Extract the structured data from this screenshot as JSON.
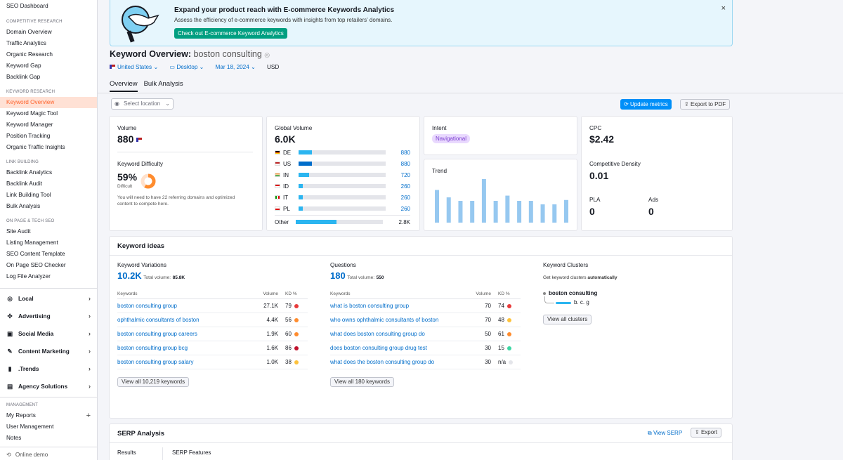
{
  "sidebar": {
    "top": "SEO Dashboard",
    "sections": [
      {
        "title": "COMPETITIVE RESEARCH",
        "items": [
          "Domain Overview",
          "Traffic Analytics",
          "Organic Research",
          "Keyword Gap",
          "Backlink Gap"
        ]
      },
      {
        "title": "KEYWORD RESEARCH",
        "items": [
          "Keyword Overview",
          "Keyword Magic Tool",
          "Keyword Manager",
          "Position Tracking",
          "Organic Traffic Insights"
        ]
      },
      {
        "title": "LINK BUILDING",
        "items": [
          "Backlink Analytics",
          "Backlink Audit",
          "Link Building Tool",
          "Bulk Analysis"
        ]
      },
      {
        "title": "ON PAGE & TECH SEO",
        "items": [
          "Site Audit",
          "Listing Management",
          "SEO Content Template",
          "On Page SEO Checker",
          "Log File Analyzer"
        ]
      }
    ],
    "groups": [
      "Local",
      "Advertising",
      "Social Media",
      "Content Marketing",
      ".Trends",
      "Agency Solutions"
    ],
    "management_title": "MANAGEMENT",
    "management": [
      "My Reports",
      "User Management",
      "Notes"
    ],
    "bottom": "Online demo"
  },
  "banner": {
    "title": "Expand your product reach with E-commerce Keywords Analytics",
    "subtitle": "Assess the efficiency of e-commerce keywords with insights from top retailers' domains.",
    "button": "Check out E-commerce Keyword Analytics",
    "close": "×"
  },
  "header": {
    "title": "Keyword Overview:",
    "keyword": "boston consulting",
    "country": "United States",
    "device": "Desktop",
    "date": "Mar 18, 2024",
    "currency": "USD",
    "tabs": [
      "Overview",
      "Bulk Analysis"
    ]
  },
  "toolbar": {
    "location_placeholder": "Select location",
    "update": "Update metrics",
    "export": "Export to PDF"
  },
  "volume": {
    "label": "Volume",
    "value": "880"
  },
  "difficulty": {
    "label": "Keyword Difficulty",
    "value": "59%",
    "level": "Difficult",
    "percent": 59,
    "note": "You will need to have 22 referring domains and optimized content to compete here."
  },
  "global": {
    "label": "Global Volume",
    "value": "6.0K",
    "rows": [
      {
        "code": "DE",
        "value": "880",
        "share": 0.15
      },
      {
        "code": "US",
        "value": "880",
        "share": 0.15
      },
      {
        "code": "IN",
        "value": "720",
        "share": 0.12
      },
      {
        "code": "ID",
        "value": "260",
        "share": 0.05
      },
      {
        "code": "IT",
        "value": "260",
        "share": 0.05
      },
      {
        "code": "PL",
        "value": "260",
        "share": 0.05
      }
    ],
    "other_label": "Other",
    "other_value": "2.8K",
    "other_share": 0.47
  },
  "intent": {
    "label": "Intent",
    "value": "Navigational"
  },
  "trend": {
    "label": "Trend",
    "values": [
      0.75,
      0.58,
      0.5,
      0.5,
      1.0,
      0.5,
      0.62,
      0.5,
      0.5,
      0.42,
      0.42,
      0.52
    ]
  },
  "cpc": {
    "label": "CPC",
    "value": "$2.42",
    "density_label": "Competitive Density",
    "density": "0.01",
    "pla_label": "PLA",
    "pla": "0",
    "ads_label": "Ads",
    "ads": "0"
  },
  "ideas": {
    "title": "Keyword ideas",
    "variations": {
      "label": "Keyword Variations",
      "count": "10.2K",
      "total_label": "Total volume:",
      "total": "85.8K",
      "headers": [
        "Keywords",
        "Volume",
        "KD %"
      ],
      "rows": [
        {
          "kw": "boston consulting group",
          "vol": "27.1K",
          "kd": "79",
          "color": "#e83b3b"
        },
        {
          "kw": "ophthalmic consultants of boston",
          "vol": "4.4K",
          "kd": "56",
          "color": "#ff8c2e"
        },
        {
          "kw": "boston consulting group careers",
          "vol": "1.9K",
          "kd": "60",
          "color": "#ff8c2e"
        },
        {
          "kw": "boston consulting group bcg",
          "vol": "1.6K",
          "kd": "86",
          "color": "#c0112c"
        },
        {
          "kw": "boston consulting group salary",
          "vol": "1.0K",
          "kd": "38",
          "color": "#fdc23c"
        }
      ],
      "button": "View all 10,219 keywords"
    },
    "questions": {
      "label": "Questions",
      "count": "180",
      "total_label": "Total volume:",
      "total": "550",
      "headers": [
        "Keywords",
        "Volume",
        "KD %"
      ],
      "rows": [
        {
          "kw": "what is boston consulting group",
          "vol": "70",
          "kd": "74",
          "color": "#e83b3b"
        },
        {
          "kw": "who owns ophthalmic consultants of boston",
          "vol": "70",
          "kd": "48",
          "color": "#fdc23c"
        },
        {
          "kw": "what does boston consulting group do",
          "vol": "50",
          "kd": "61",
          "color": "#ff8c2e"
        },
        {
          "kw": "does boston consulting group drug test",
          "vol": "30",
          "kd": "15",
          "color": "#3cd6a3"
        },
        {
          "kw": "what does the boston consulting group do",
          "vol": "30",
          "kd": "n/a",
          "color": "#e4e5ea"
        }
      ],
      "button": "View all 180 keywords"
    },
    "clusters": {
      "label": "Keyword Clusters",
      "sub_pre": "Get keyword clusters",
      "sub_bold": "automatically",
      "root": "boston consulting",
      "child": "b. c. g",
      "button": "View all clusters"
    }
  },
  "serp": {
    "title": "SERP Analysis",
    "view": "View SERP",
    "export": "Export",
    "col1": "Results",
    "col2": "SERP Features"
  }
}
